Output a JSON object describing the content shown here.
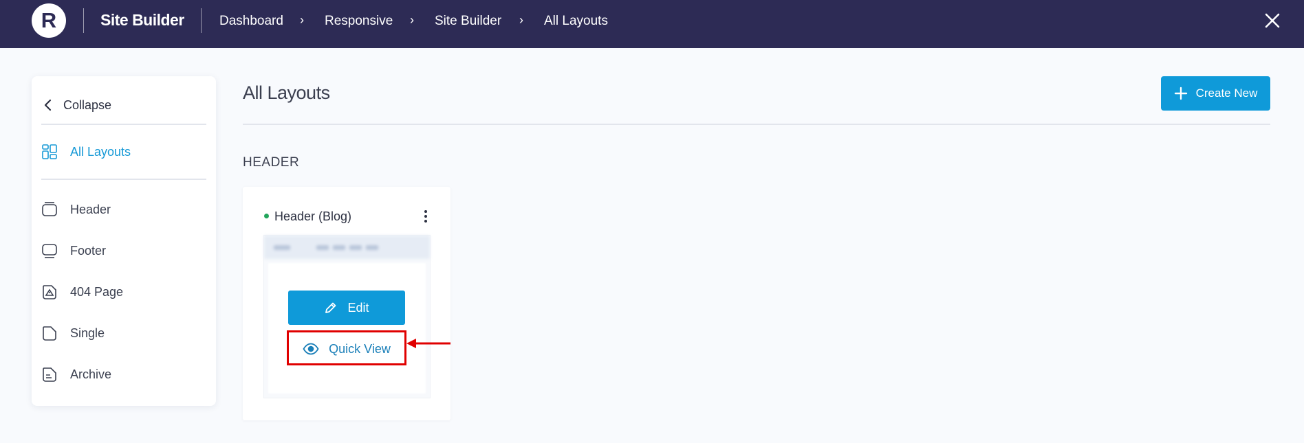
{
  "topbar": {
    "logo_letter": "R",
    "app_title": "Site Builder",
    "breadcrumbs": [
      "Dashboard",
      "Responsive",
      "Site Builder",
      "All Layouts"
    ],
    "breadcrumb_separator": "›"
  },
  "sidebar": {
    "collapse_label": "Collapse",
    "items": [
      {
        "label": "All Layouts",
        "icon": "grid-icon",
        "active": true
      },
      {
        "label": "Header",
        "icon": "header-icon",
        "active": false
      },
      {
        "label": "Footer",
        "icon": "footer-icon",
        "active": false
      },
      {
        "label": "404 Page",
        "icon": "warning-page-icon",
        "active": false
      },
      {
        "label": "Single",
        "icon": "page-icon",
        "active": false
      },
      {
        "label": "Archive",
        "icon": "archive-icon",
        "active": false
      }
    ]
  },
  "main": {
    "page_title": "All Layouts",
    "create_button_label": "Create New",
    "section_label": "HEADER",
    "card": {
      "title": "Header (Blog)",
      "status_color": "#22a55b",
      "edit_label": "Edit",
      "quick_view_label": "Quick View"
    }
  },
  "colors": {
    "topbar_bg": "#2d2b55",
    "accent": "#0f9ad9",
    "active_link": "#1699d6",
    "highlight_annotation": "#e00000"
  }
}
